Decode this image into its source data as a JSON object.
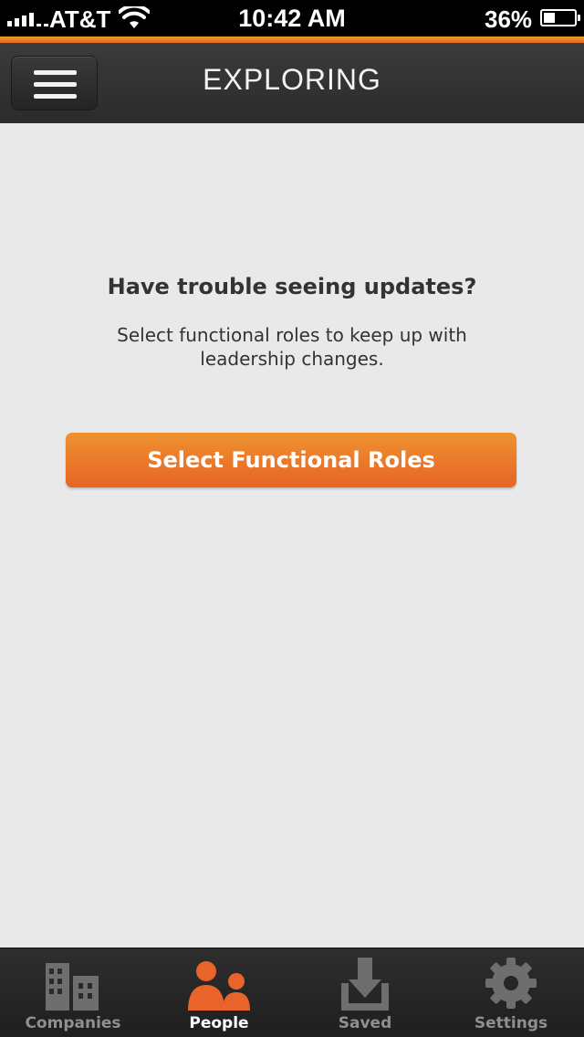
{
  "status_bar": {
    "carrier": "AT&T",
    "time": "10:42 AM",
    "battery": "36%",
    "battery_level": 0.36,
    "icons": [
      "signal-icon",
      "wifi-icon",
      "battery-icon"
    ]
  },
  "colors": {
    "accent": "#e86a22",
    "header_bg": "#333333",
    "content_bg": "#e9e9e9",
    "tabbar_bg": "#262626",
    "tab_active": "#e8642a",
    "tab_inactive": "#7a7a7a"
  },
  "header": {
    "title": "EXPLORING",
    "menu_icon": "hamburger-menu-icon"
  },
  "main": {
    "heading": "Have trouble seeing updates?",
    "body": "Select functional roles to keep up with leadership changes.",
    "cta_label": "Select Functional Roles"
  },
  "tabs": [
    {
      "label": "Companies",
      "icon": "buildings-icon",
      "active": false
    },
    {
      "label": "People",
      "icon": "people-icon",
      "active": true
    },
    {
      "label": "Saved",
      "icon": "download-tray-icon",
      "active": false
    },
    {
      "label": "Settings",
      "icon": "gear-icon",
      "active": false
    }
  ]
}
